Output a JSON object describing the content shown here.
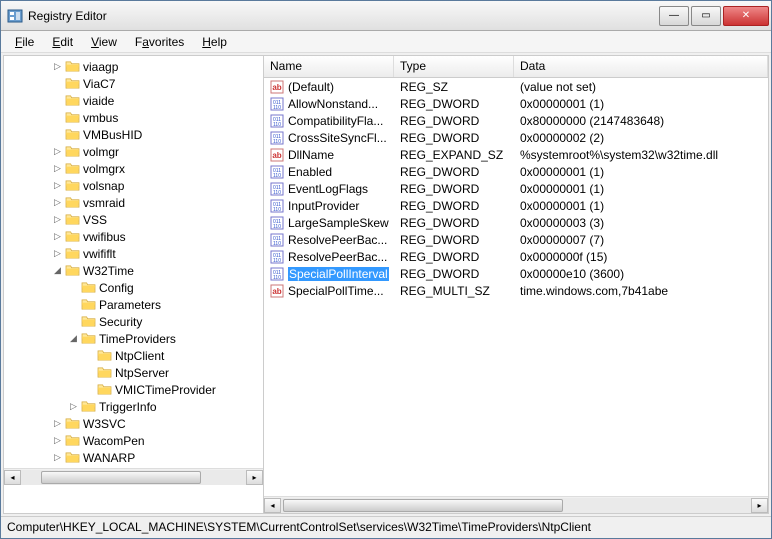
{
  "window": {
    "title": "Registry Editor"
  },
  "menu": {
    "file": "File",
    "edit": "Edit",
    "view": "View",
    "favorites": "Favorites",
    "help": "Help"
  },
  "tree": {
    "items": [
      {
        "depth": 3,
        "exp": "▷",
        "label": "viaagp"
      },
      {
        "depth": 3,
        "exp": "",
        "label": "ViaC7"
      },
      {
        "depth": 3,
        "exp": "",
        "label": "viaide"
      },
      {
        "depth": 3,
        "exp": "",
        "label": "vmbus"
      },
      {
        "depth": 3,
        "exp": "",
        "label": "VMBusHID"
      },
      {
        "depth": 3,
        "exp": "▷",
        "label": "volmgr"
      },
      {
        "depth": 3,
        "exp": "▷",
        "label": "volmgrx"
      },
      {
        "depth": 3,
        "exp": "▷",
        "label": "volsnap"
      },
      {
        "depth": 3,
        "exp": "▷",
        "label": "vsmraid"
      },
      {
        "depth": 3,
        "exp": "▷",
        "label": "VSS"
      },
      {
        "depth": 3,
        "exp": "▷",
        "label": "vwifibus"
      },
      {
        "depth": 3,
        "exp": "▷",
        "label": "vwififlt"
      },
      {
        "depth": 3,
        "exp": "◢",
        "label": "W32Time"
      },
      {
        "depth": 4,
        "exp": "",
        "label": "Config"
      },
      {
        "depth": 4,
        "exp": "",
        "label": "Parameters"
      },
      {
        "depth": 4,
        "exp": "",
        "label": "Security"
      },
      {
        "depth": 4,
        "exp": "◢",
        "label": "TimeProviders"
      },
      {
        "depth": 5,
        "exp": "",
        "label": "NtpClient"
      },
      {
        "depth": 5,
        "exp": "",
        "label": "NtpServer"
      },
      {
        "depth": 5,
        "exp": "",
        "label": "VMICTimeProvider"
      },
      {
        "depth": 4,
        "exp": "▷",
        "label": "TriggerInfo"
      },
      {
        "depth": 3,
        "exp": "▷",
        "label": "W3SVC"
      },
      {
        "depth": 3,
        "exp": "▷",
        "label": "WacomPen"
      },
      {
        "depth": 3,
        "exp": "▷",
        "label": "WANARP"
      }
    ]
  },
  "list": {
    "headers": {
      "name": "Name",
      "type": "Type",
      "data": "Data"
    },
    "rows": [
      {
        "icon": "str",
        "name": "(Default)",
        "type": "REG_SZ",
        "data": "(value not set)",
        "sel": false
      },
      {
        "icon": "bin",
        "name": "AllowNonstand...",
        "type": "REG_DWORD",
        "data": "0x00000001 (1)",
        "sel": false
      },
      {
        "icon": "bin",
        "name": "CompatibilityFla...",
        "type": "REG_DWORD",
        "data": "0x80000000 (2147483648)",
        "sel": false
      },
      {
        "icon": "bin",
        "name": "CrossSiteSyncFl...",
        "type": "REG_DWORD",
        "data": "0x00000002 (2)",
        "sel": false
      },
      {
        "icon": "str",
        "name": "DllName",
        "type": "REG_EXPAND_SZ",
        "data": "%systemroot%\\system32\\w32time.dll",
        "sel": false
      },
      {
        "icon": "bin",
        "name": "Enabled",
        "type": "REG_DWORD",
        "data": "0x00000001 (1)",
        "sel": false
      },
      {
        "icon": "bin",
        "name": "EventLogFlags",
        "type": "REG_DWORD",
        "data": "0x00000001 (1)",
        "sel": false
      },
      {
        "icon": "bin",
        "name": "InputProvider",
        "type": "REG_DWORD",
        "data": "0x00000001 (1)",
        "sel": false
      },
      {
        "icon": "bin",
        "name": "LargeSampleSkew",
        "type": "REG_DWORD",
        "data": "0x00000003 (3)",
        "sel": false
      },
      {
        "icon": "bin",
        "name": "ResolvePeerBac...",
        "type": "REG_DWORD",
        "data": "0x00000007 (7)",
        "sel": false
      },
      {
        "icon": "bin",
        "name": "ResolvePeerBac...",
        "type": "REG_DWORD",
        "data": "0x0000000f (15)",
        "sel": false
      },
      {
        "icon": "bin",
        "name": "SpecialPollInterval",
        "type": "REG_DWORD",
        "data": "0x00000e10 (3600)",
        "sel": true
      },
      {
        "icon": "str",
        "name": "SpecialPollTime...",
        "type": "REG_MULTI_SZ",
        "data": "time.windows.com,7b41abe",
        "sel": false
      }
    ]
  },
  "statusbar": {
    "path": "Computer\\HKEY_LOCAL_MACHINE\\SYSTEM\\CurrentControlSet\\services\\W32Time\\TimeProviders\\NtpClient"
  }
}
